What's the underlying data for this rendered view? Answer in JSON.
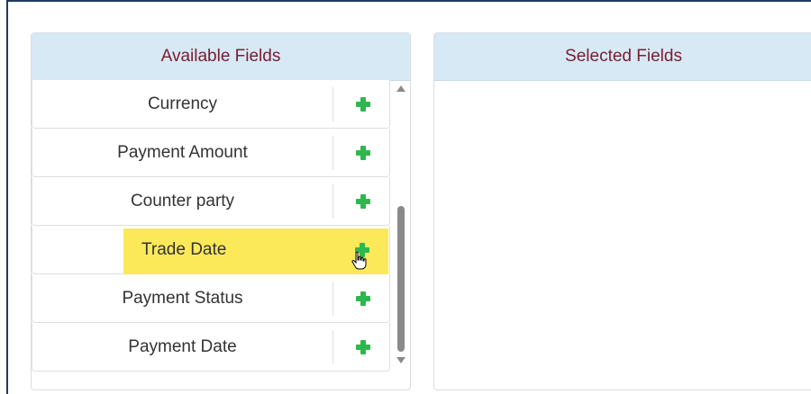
{
  "available_fields": {
    "title": "Available Fields",
    "items": [
      {
        "label": "Currency",
        "icon": "plus-icon"
      },
      {
        "label": "Payment Amount",
        "icon": "plus-icon"
      },
      {
        "label": "Counter party",
        "icon": "plus-icon"
      },
      {
        "label": "Trade Date",
        "icon": "plus-icon",
        "highlighted": true
      },
      {
        "label": "Payment Status",
        "icon": "plus-icon"
      },
      {
        "label": "Payment Date",
        "icon": "plus-icon"
      }
    ]
  },
  "selected_fields": {
    "title": "Selected Fields",
    "items": []
  },
  "colors": {
    "header_bg": "#d6e9f5",
    "header_text": "#7a1d2e",
    "add_icon": "#2db84d",
    "highlight": "#fbe95a",
    "frame_border": "#1f3b5c"
  }
}
